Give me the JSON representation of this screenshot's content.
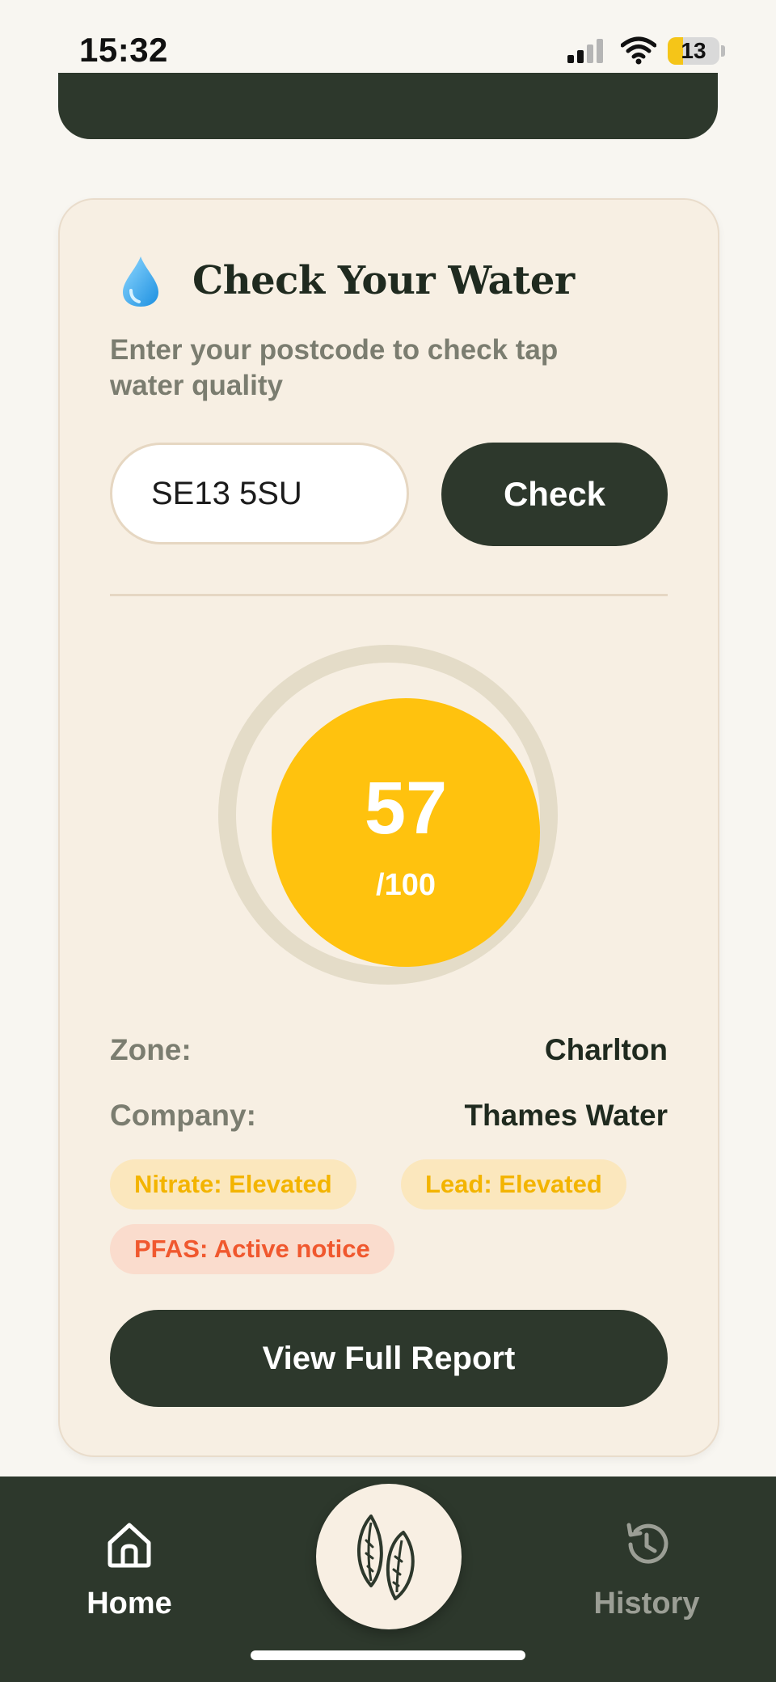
{
  "status_bar": {
    "time": "15:32",
    "battery": "13",
    "battery_level": 0.13
  },
  "water_check": {
    "icon": "water-drop-icon",
    "title": "Check Your Water",
    "subtitle": "Enter your postcode to check tap water quality",
    "postcode_value": "SE13 5SU",
    "check_label": "Check",
    "score": {
      "value": "57",
      "max": "/100",
      "color": "#ffc20e"
    },
    "zone_label": "Zone:",
    "zone_value": "Charlton",
    "company_label": "Company:",
    "company_value": "Thames Water",
    "badges": [
      {
        "text": "Nitrate: Elevated",
        "status": "warning",
        "color": "#f3b400"
      },
      {
        "text": "Lead: Elevated",
        "status": "warning",
        "color": "#f3b400"
      },
      {
        "text": "PFAS: Active notice",
        "status": "alert",
        "color": "#f0582e"
      }
    ],
    "report_label": "View Full Report"
  },
  "nav": {
    "home": {
      "label": "Home",
      "icon": "home-icon"
    },
    "center": {
      "icon": "almond-icon"
    },
    "history": {
      "label": "History",
      "icon": "history-icon"
    }
  },
  "colors": {
    "primary_dark": "#2d382c",
    "card_bg": "#f7efe3",
    "page_bg": "#f8f6f1"
  }
}
